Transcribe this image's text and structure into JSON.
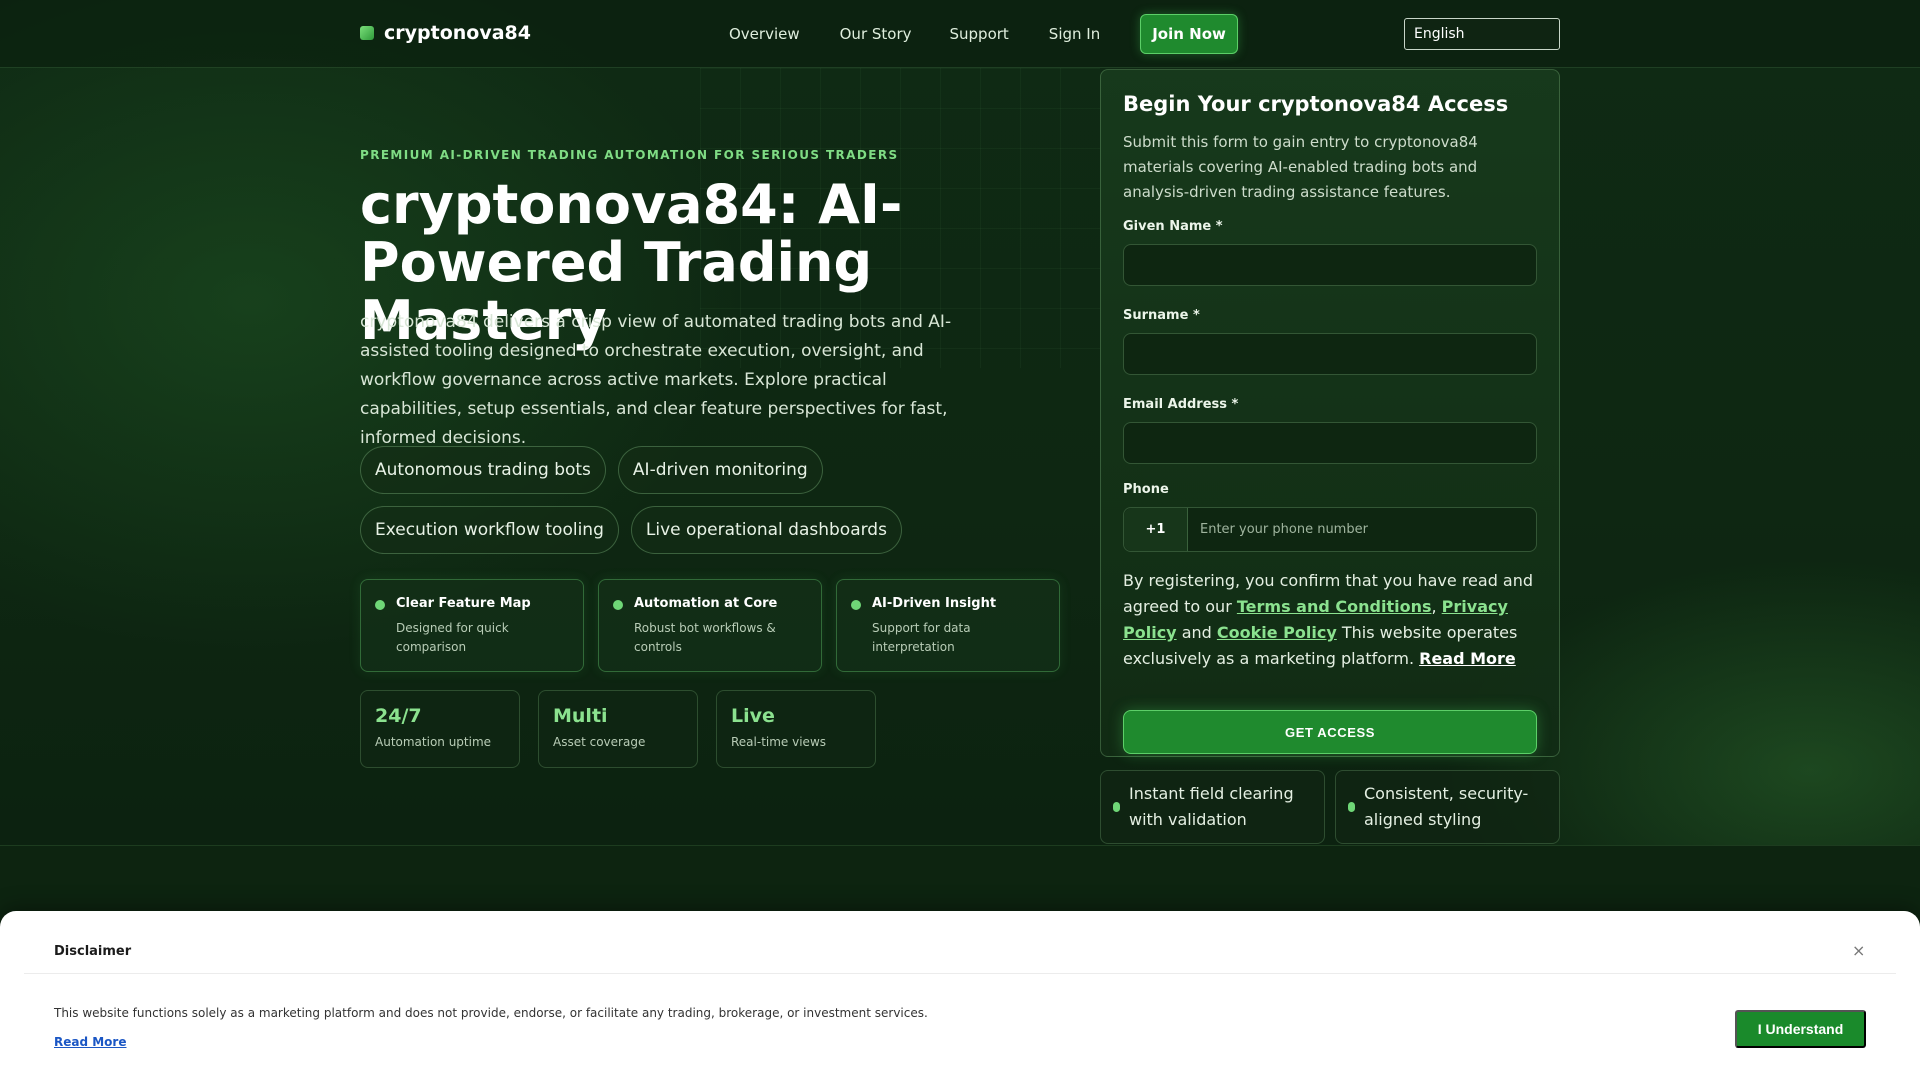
{
  "header": {
    "brand": "cryptonova84",
    "nav": [
      "Overview",
      "Our Story",
      "Support",
      "Sign In"
    ],
    "join_label": "Join Now",
    "language": "English"
  },
  "hero": {
    "eyebrow": "PREMIUM AI-DRIVEN TRADING AUTOMATION FOR SERIOUS TRADERS",
    "title": "cryptonova84: AI-Powered Trading Mastery",
    "description": "cryptonova84 delivers a crisp view of automated trading bots and AI-assisted tooling designed to orchestrate execution, oversight, and workflow governance across active markets. Explore practical capabilities, setup essentials, and clear feature perspectives for fast, informed decisions.",
    "chips": [
      "Autonomous trading bots",
      "AI-driven monitoring",
      "Execution workflow tooling",
      "Live operational dashboards"
    ],
    "features": [
      {
        "title": "Clear Feature Map",
        "subtitle": "Designed for quick comparison"
      },
      {
        "title": "Automation at Core",
        "subtitle": "Robust bot workflows & controls"
      },
      {
        "title": "AI-Driven Insight",
        "subtitle": "Support for data interpretation"
      }
    ],
    "stats": [
      {
        "value": "24/7",
        "label": "Automation uptime"
      },
      {
        "value": "Multi",
        "label": "Asset coverage"
      },
      {
        "value": "Live",
        "label": "Real-time views"
      }
    ]
  },
  "form": {
    "title": "Begin Your cryptonova84 Access",
    "intro": "Submit this form to gain entry to cryptonova84 materials covering AI-enabled trading bots and analysis-driven trading assistance features.",
    "given_name_label": "Given Name *",
    "surname_label": "Surname *",
    "email_label": "Email Address *",
    "phone_label": "Phone",
    "phone_code": "+1",
    "phone_placeholder": "Enter your phone number",
    "consent_prefix": "By registering, you confirm that you have read and agreed to our",
    "terms": "Terms and Conditions",
    "comma": ",",
    "privacy": "Privacy Policy",
    "and": "and",
    "cookie": "Cookie Policy",
    "consent_suffix": "This website operates exclusively as a marketing platform.",
    "read_more": "Read More",
    "submit_label": "GET ACCESS",
    "notes": [
      "Instant field clearing with validation",
      "Consistent, security-aligned styling"
    ]
  },
  "disclaimer": {
    "title": "Disclaimer",
    "close": "×",
    "text": "This website functions solely as a marketing platform and does not provide, endorse, or facilitate any trading, brokerage, or investment services.",
    "read_more": "Read More",
    "button": "I Understand"
  }
}
